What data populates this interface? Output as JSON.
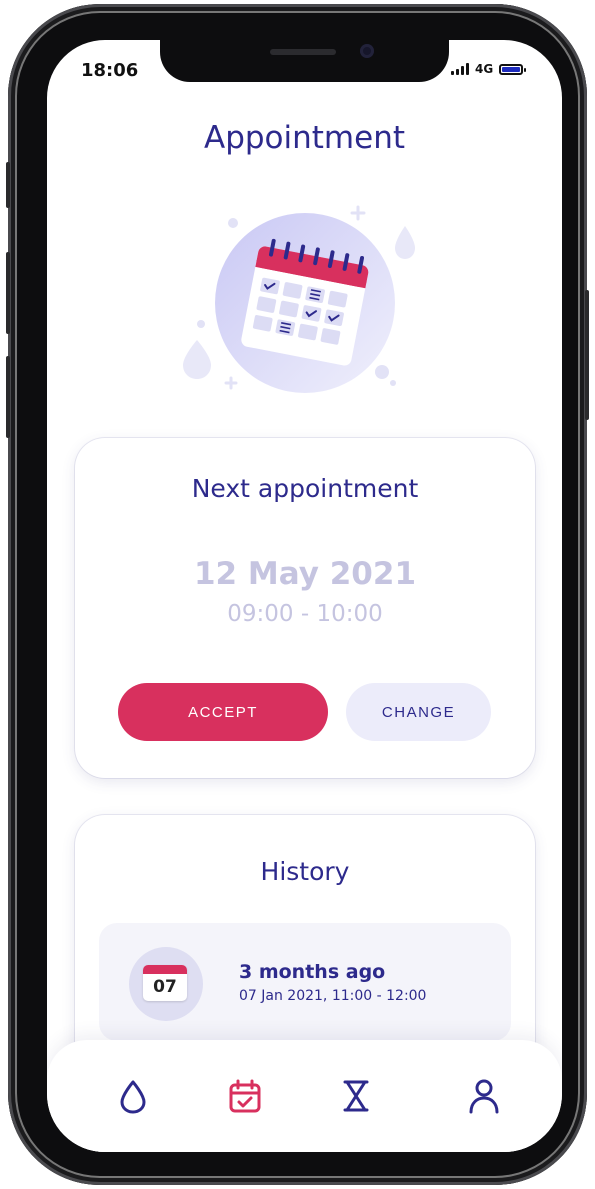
{
  "status_bar": {
    "time": "18:06",
    "network": "4G"
  },
  "page": {
    "title": "Appointment"
  },
  "next_appointment": {
    "title": "Next appointment",
    "date": "12 May 2021",
    "time_range": "09:00 - 10:00",
    "accept_label": "ACCEPT",
    "change_label": "CHANGE"
  },
  "history": {
    "title": "History",
    "items": [
      {
        "day": "07",
        "relative": "3 months ago",
        "detail": "07 Jan 2021, 11:00 - 12:00"
      }
    ]
  },
  "tabbar": {
    "items": [
      {
        "icon": "drop-icon",
        "active": false
      },
      {
        "icon": "calendar-check-icon",
        "active": true
      },
      {
        "icon": "hourglass-icon",
        "active": false
      },
      {
        "icon": "user-icon",
        "active": false
      }
    ]
  },
  "colors": {
    "primary": "#2d2a8c",
    "accent": "#d8305e",
    "muted_date": "#c5c4e0",
    "change_bg": "#ececfa"
  }
}
